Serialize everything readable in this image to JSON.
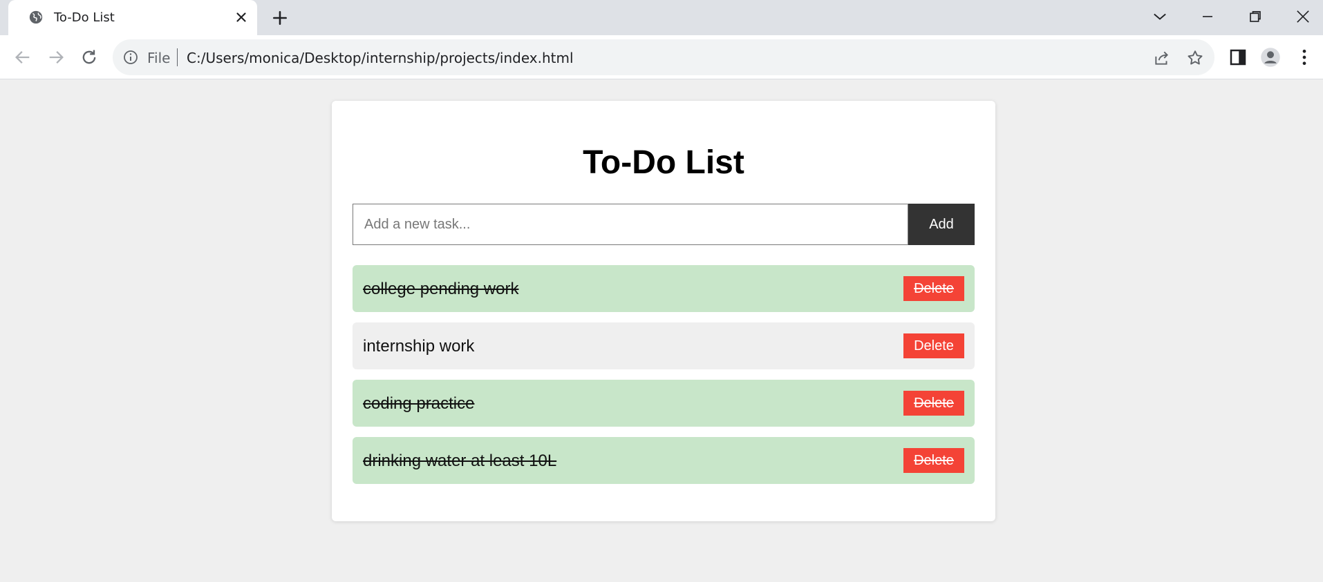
{
  "browser": {
    "tab_title": "To-Do List",
    "address_scheme": "File",
    "address_url": "C:/Users/monica/Desktop/internship/projects/index.html",
    "icons": {
      "favicon": "globe-icon",
      "tab_close": "close-icon",
      "new_tab": "plus-icon",
      "back": "back-arrow-icon",
      "forward": "forward-arrow-icon",
      "reload": "reload-icon",
      "info": "info-icon",
      "share": "share-icon",
      "bookmark": "star-icon",
      "side_panel": "side-panel-icon",
      "profile": "profile-icon",
      "menu": "kebab-menu-icon",
      "tab_search": "chevron-down-icon",
      "minimize": "minimize-icon",
      "restore": "restore-icon",
      "close_window": "close-window-icon"
    }
  },
  "app": {
    "title": "To-Do List",
    "input": {
      "placeholder": "Add a new task...",
      "value": ""
    },
    "add_label": "Add",
    "tasks": [
      {
        "text": "college pending work",
        "completed": true,
        "delete_label": "Delete"
      },
      {
        "text": "internship work",
        "completed": false,
        "delete_label": "Delete"
      },
      {
        "text": "coding practice",
        "completed": true,
        "delete_label": "Delete"
      },
      {
        "text": "drinking water at least 10L",
        "completed": true,
        "delete_label": "Delete"
      }
    ]
  },
  "colors": {
    "completed_bg": "#c8e6c9",
    "pending_bg": "#efefef",
    "delete_button": "#f44336",
    "add_button": "#333333"
  }
}
